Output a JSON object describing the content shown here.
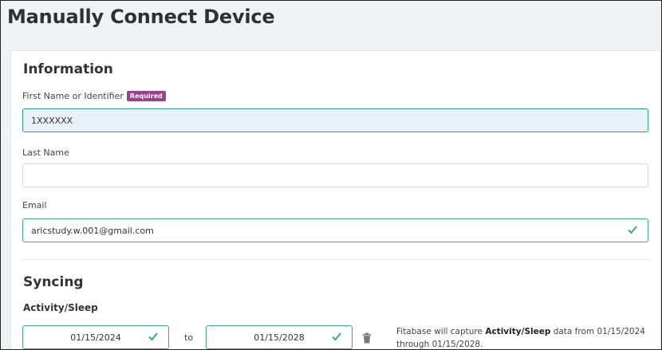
{
  "page": {
    "title": "Manually Connect Device"
  },
  "information": {
    "title": "Information",
    "first_name": {
      "label": "First Name or Identifier",
      "badge": "Required",
      "value": "1XXXXXX"
    },
    "last_name": {
      "label": "Last Name",
      "value": ""
    },
    "email": {
      "label": "Email",
      "value": "aricstudy.w.001@gmail.com"
    }
  },
  "syncing": {
    "title": "Syncing",
    "activity_sleep": {
      "title": "Activity/Sleep",
      "start_date": "01/15/2024",
      "to_label": "to",
      "end_date": "01/15/2028",
      "note_prefix": "Fitabase will capture ",
      "note_bold": "Activity/Sleep",
      "note_suffix": " data from 01/15/2024 through 01/15/2028."
    }
  },
  "colors": {
    "accent": "#3aa98f",
    "badge": "#9c3f8e",
    "focused_bg": "#e9f1f8"
  }
}
